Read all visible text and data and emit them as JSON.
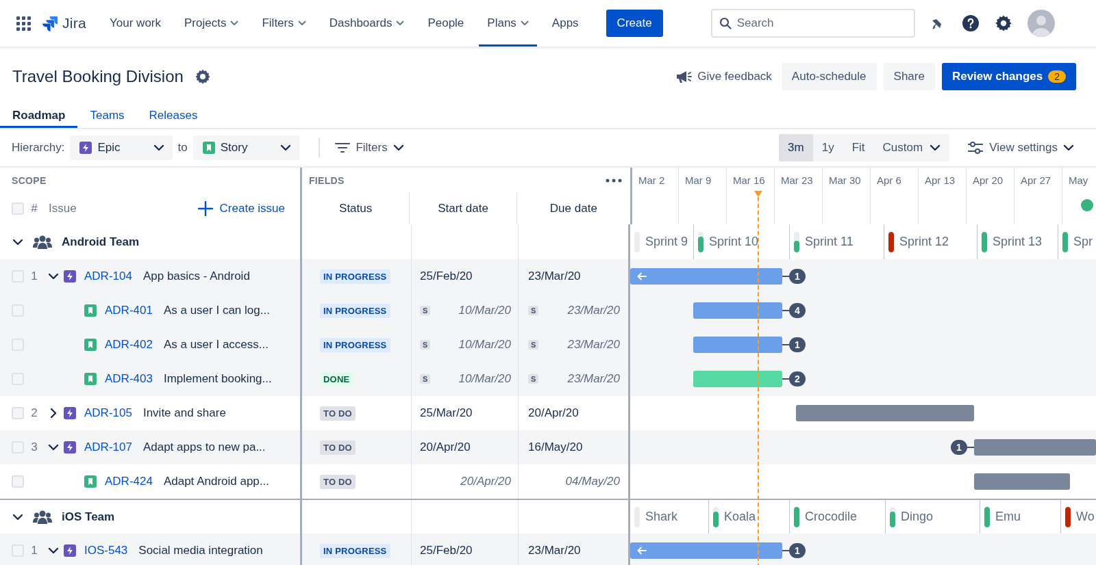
{
  "nav": {
    "product": "Jira",
    "items": [
      {
        "label": "Your work",
        "dropdown": false,
        "selected": false
      },
      {
        "label": "Projects",
        "dropdown": true,
        "selected": false
      },
      {
        "label": "Filters",
        "dropdown": true,
        "selected": false
      },
      {
        "label": "Dashboards",
        "dropdown": true,
        "selected": false
      },
      {
        "label": "People",
        "dropdown": false,
        "selected": false
      },
      {
        "label": "Plans",
        "dropdown": true,
        "selected": true
      },
      {
        "label": "Apps",
        "dropdown": false,
        "selected": false
      }
    ],
    "create": "Create",
    "search": {
      "placeholder": "Search"
    }
  },
  "header": {
    "title": "Travel Booking Division",
    "actions": [
      {
        "label": "Give feedback",
        "kind": "link"
      },
      {
        "label": "Auto-schedule",
        "kind": "secondary"
      },
      {
        "label": "Share",
        "kind": "secondary"
      },
      {
        "label": "Review changes",
        "kind": "primary",
        "badge": "2"
      }
    ]
  },
  "tabs": [
    {
      "label": "Roadmap",
      "selected": true
    },
    {
      "label": "Teams",
      "selected": false
    },
    {
      "label": "Releases",
      "selected": false
    }
  ],
  "toolbar": {
    "hierarchy_label": "Hierarchy:",
    "from": {
      "label": "Epic",
      "kind": "epic"
    },
    "connector": "to",
    "to": {
      "label": "Story",
      "kind": "story"
    },
    "filters": "Filters",
    "ranges": [
      {
        "label": "3m",
        "selected": true,
        "dropdown": false
      },
      {
        "label": "1y",
        "selected": false,
        "dropdown": false
      },
      {
        "label": "Fit",
        "selected": false,
        "dropdown": false
      },
      {
        "label": "Custom",
        "selected": false,
        "dropdown": true
      }
    ],
    "view_settings": "View settings"
  },
  "scope": {
    "heading": "SCOPE",
    "select_all_checked": false,
    "number_header": "#",
    "issue_header": "Issue",
    "create_issue": "Create issue"
  },
  "fields": {
    "heading": "FIELDS",
    "columns": [
      "Status",
      "Start date",
      "Due date"
    ]
  },
  "timeline": {
    "weeks": [
      "Mar 2",
      "Mar 9",
      "Mar 16",
      "Mar 23",
      "Mar 30",
      "Apr 6",
      "Apr 13",
      "Apr 20",
      "Apr 27",
      "May"
    ]
  },
  "teams": [
    {
      "name": "Android Team",
      "expanded": true,
      "sprints": [
        {
          "name": "Sprint 9",
          "level": 0
        },
        {
          "name": "Sprint 10",
          "level": 0.75,
          "color": "#36b37e"
        },
        {
          "name": "Sprint 11",
          "level": 0.55,
          "color": "#36b37e"
        },
        {
          "name": "Sprint 12",
          "level": 1,
          "color": "#bf2600"
        },
        {
          "name": "Sprint 13",
          "level": 1,
          "color": "#36b37e"
        },
        {
          "name": "Spr",
          "level": 1,
          "color": "#36b37e"
        }
      ],
      "issues": [
        {
          "number": "1",
          "kind": "epic",
          "key": "ADR-104",
          "summary": "App basics - Android",
          "checked": false,
          "expanded": true,
          "highlighted": true,
          "status": {
            "label": "IN PROGRESS",
            "kind": "inprogress"
          },
          "start": {
            "text": "25/Feb/20",
            "inherited": false
          },
          "due": {
            "text": "23/Mar/20",
            "inherited": false
          },
          "dependencies": {
            "count": "1",
            "leading": false
          },
          "children": [
            {
              "kind": "story",
              "key": "ADR-401",
              "summary": "As a user I can log...",
              "checked": false,
              "highlighted": true,
              "status": {
                "label": "IN PROGRESS",
                "kind": "inprogress"
              },
              "start": {
                "text": "10/Mar/20",
                "inherited": true,
                "tag": "S"
              },
              "due": {
                "text": "23/Mar/20",
                "inherited": true,
                "tag": "S"
              },
              "dependencies": {
                "count": "4",
                "leading": false
              }
            },
            {
              "kind": "story",
              "key": "ADR-402",
              "summary": "As a user I access...",
              "checked": false,
              "highlighted": true,
              "status": {
                "label": "IN PROGRESS",
                "kind": "inprogress"
              },
              "start": {
                "text": "10/Mar/20",
                "inherited": true,
                "tag": "S"
              },
              "due": {
                "text": "23/Mar/20",
                "inherited": true,
                "tag": "S"
              },
              "dependencies": {
                "count": "1",
                "leading": false
              }
            },
            {
              "kind": "story",
              "key": "ADR-403",
              "summary": "Implement booking...",
              "checked": false,
              "highlighted": true,
              "status": {
                "label": "DONE",
                "kind": "done"
              },
              "start": {
                "text": "10/Mar/20",
                "inherited": true,
                "tag": "S"
              },
              "due": {
                "text": "23/Mar/20",
                "inherited": true,
                "tag": "S"
              },
              "dependencies": {
                "count": "2",
                "leading": false
              }
            }
          ]
        },
        {
          "number": "2",
          "kind": "epic",
          "key": "ADR-105",
          "summary": "Invite and share",
          "checked": false,
          "expanded": false,
          "highlighted": false,
          "status": {
            "label": "TO DO",
            "kind": "todo"
          },
          "start": {
            "text": "25/Mar/20",
            "inherited": false
          },
          "due": {
            "text": "20/Apr/20",
            "inherited": false
          }
        },
        {
          "number": "3",
          "kind": "epic",
          "key": "ADR-107",
          "summary": "Adapt apps to new pa...",
          "checked": false,
          "expanded": true,
          "highlighted": true,
          "status": {
            "label": "TO DO",
            "kind": "todo"
          },
          "start": {
            "text": "20/Apr/20",
            "inherited": false
          },
          "due": {
            "text": "16/May/20",
            "inherited": false
          },
          "dependencies": {
            "count": "1",
            "leading": true
          },
          "children": [
            {
              "kind": "story",
              "key": "ADR-424",
              "summary": "Adapt Android app...",
              "checked": false,
              "highlighted": false,
              "status": {
                "label": "TO DO",
                "kind": "todo"
              },
              "start": {
                "text": "20/Apr/20",
                "inherited": true
              },
              "due": {
                "text": "04/May/20",
                "inherited": true
              }
            }
          ]
        }
      ]
    },
    {
      "name": "iOS Team",
      "expanded": true,
      "sprints": [
        {
          "name": "Shark",
          "level": 0
        },
        {
          "name": "Koala",
          "level": 0.75,
          "color": "#36b37e"
        },
        {
          "name": "Crocodile",
          "level": 1,
          "color": "#36b37e"
        },
        {
          "name": "Dingo",
          "level": 0.75,
          "color": "#36b37e"
        },
        {
          "name": "Emu",
          "level": 1,
          "color": "#36b37e"
        },
        {
          "name": "Wo",
          "level": 1,
          "color": "#bf2600"
        }
      ],
      "issues": [
        {
          "number": "1",
          "kind": "epic",
          "key": "IOS-543",
          "summary": "Social media integration",
          "checked": false,
          "expanded": true,
          "highlighted": true,
          "status": {
            "label": "IN PROGRESS",
            "kind": "inprogress"
          },
          "start": {
            "text": "25/Feb/20",
            "inherited": false
          },
          "due": {
            "text": "23/Mar/20",
            "inherited": false
          },
          "dependencies": {
            "count": "1",
            "leading": false
          }
        }
      ]
    }
  ]
}
